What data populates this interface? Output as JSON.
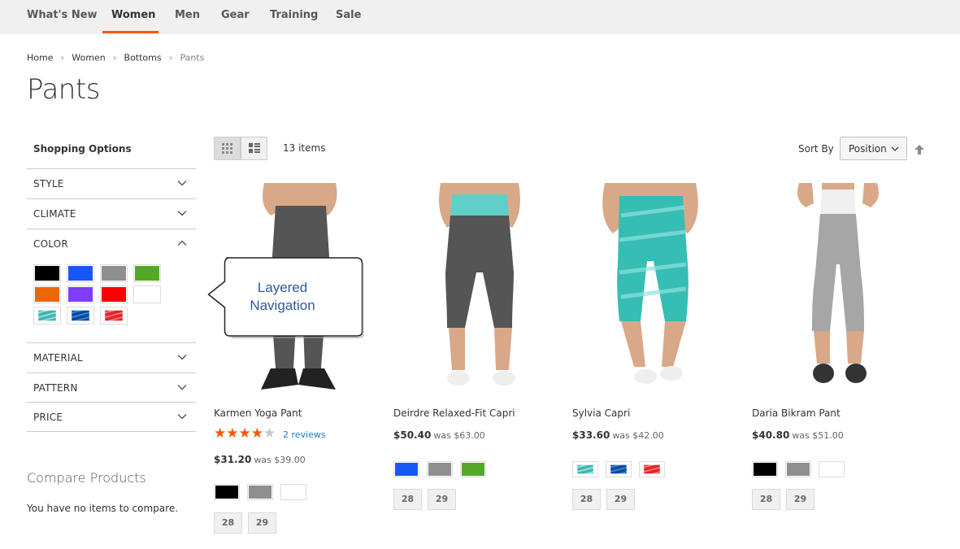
{
  "nav": {
    "items": [
      "What's New",
      "Women",
      "Men",
      "Gear",
      "Training",
      "Sale"
    ],
    "active": "Women",
    "accent_color": "#ff5501"
  },
  "breadcrumb": [
    "Home",
    "Women",
    "Bottoms",
    "Pants"
  ],
  "page_title": "Pants",
  "sidebar": {
    "heading": "Shopping Options",
    "filters": [
      {
        "label": "STYLE",
        "expanded": false
      },
      {
        "label": "CLIMATE",
        "expanded": false
      },
      {
        "label": "COLOR",
        "expanded": true
      },
      {
        "label": "MATERIAL",
        "expanded": false
      },
      {
        "label": "PATTERN",
        "expanded": false
      },
      {
        "label": "PRICE",
        "expanded": false
      }
    ],
    "color_swatches": [
      "#000000",
      "#1857f7",
      "#8f8f8f",
      "#53a828",
      "#eb6703",
      "#7e3df7",
      "#fe0000",
      "#ffffff",
      "teal-pattern",
      "blue-pattern",
      "red-pattern"
    ],
    "compare_title": "Compare Products",
    "compare_empty": "You have no items to compare."
  },
  "toolbar": {
    "item_count": "13 items",
    "sort_label": "Sort By",
    "sort_value": "Position"
  },
  "callout": {
    "line1": "Layered",
    "line2": "Navigation"
  },
  "products": [
    {
      "name": "Karmen Yoga Pant",
      "rating_stars": 4,
      "reviews": "2 reviews",
      "price": "$31.20",
      "was": "was $39.00",
      "colors": [
        "#000000",
        "#8f8f8f",
        "#ffffff"
      ],
      "sizes": [
        "28",
        "29"
      ]
    },
    {
      "name": "Deirdre Relaxed-Fit Capri",
      "price": "$50.40",
      "was": "was $63.00",
      "colors": [
        "#1857f7",
        "#8f8f8f",
        "#53a828"
      ],
      "sizes": [
        "28",
        "29"
      ]
    },
    {
      "name": "Sylvia Capri",
      "price": "$33.60",
      "was": "was $42.00",
      "colors": [
        "teal-pattern",
        "blue-pattern",
        "red-pattern"
      ],
      "sizes": [
        "28",
        "29"
      ]
    },
    {
      "name": "Daria Bikram Pant",
      "price": "$40.80",
      "was": "was $51.00",
      "colors": [
        "#000000",
        "#8f8f8f",
        "#ffffff"
      ],
      "sizes": [
        "28",
        "29"
      ]
    }
  ]
}
